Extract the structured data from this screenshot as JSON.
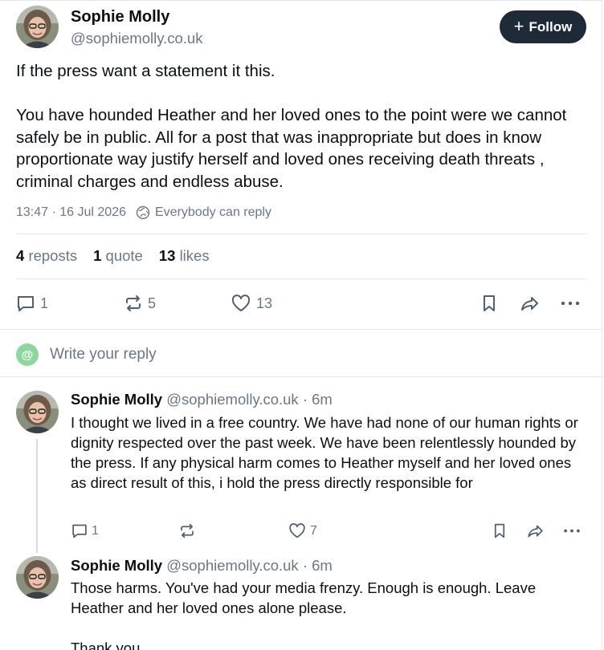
{
  "post": {
    "author_name": "Sophie Molly",
    "author_handle": "@sophiemolly.co.uk",
    "follow_label": "Follow",
    "text": "If the press want a statement it this.\n\nYou have hounded Heather and her loved ones to the point were we cannot safely be in public. All for a post that was inappropriate but does in know proportionate way justify herself and loved ones receiving death threats , criminal charges and endless abuse.",
    "timestamp": "13:47 · 16 Jul 2026",
    "reply_setting": "Everybody can reply",
    "stats": {
      "reposts_count": "4",
      "reposts_label": "reposts",
      "quotes_count": "1",
      "quotes_label": "quote",
      "likes_count": "13",
      "likes_label": "likes"
    },
    "actions": {
      "replies": "1",
      "reposts": "5",
      "likes": "13"
    }
  },
  "composer": {
    "placeholder": "Write your reply"
  },
  "replies": [
    {
      "author_name": "Sophie Molly",
      "author_handle": "@sophiemolly.co.uk",
      "time": "· 6m",
      "text": "I thought we lived in a free country. We have had none of our human rights or dignity respected over the past week. We have been relentlessly hounded by the press. If any physical harm comes to Heather myself and her loved ones as direct result of this, i hold the press directly responsible for",
      "replies": "1",
      "likes": "7"
    },
    {
      "author_name": "Sophie Molly",
      "author_handle": "@sophiemolly.co.uk",
      "time": "· 6m",
      "text": "Those harms. You've had your media frenzy. Enough is enough. Leave Heather and her loved ones alone please.\n\nThank you"
    }
  ],
  "colors": {
    "text": "#0b0f14",
    "muted": "#6b7785",
    "follow_bg": "#1e2a37",
    "composer_avatar": "#8bd79c",
    "divider": "#e4e7eb"
  }
}
